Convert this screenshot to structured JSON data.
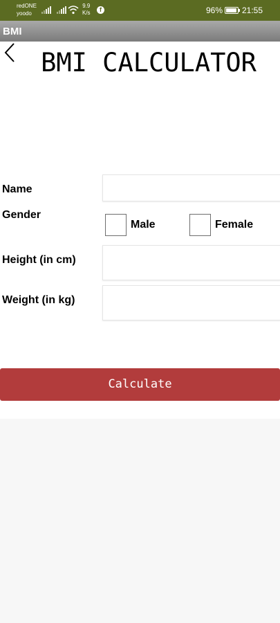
{
  "status_bar": {
    "carrier_line1": "redONE",
    "carrier_line2": "yoodo",
    "speed_value": "9.9",
    "speed_unit": "K/s",
    "battery_percent": "96%",
    "battery_level": 0.96,
    "time": "21:55",
    "icons": [
      "signal-icon",
      "signal-icon",
      "wifi-icon",
      "facebook-icon",
      "battery-icon"
    ]
  },
  "app_bar": {
    "title": "BMI"
  },
  "header": {
    "title": "BMI CALCULATOR",
    "back_icon": "chevron-left-icon"
  },
  "form": {
    "name_label": "Name",
    "name_value": "",
    "gender_label": "Gender",
    "male_label": "Male",
    "male_checked": false,
    "female_label": "Female",
    "female_checked": false,
    "height_label": "Height (in cm)",
    "height_value": "",
    "weight_label": "Weight (in kg)",
    "weight_value": ""
  },
  "actions": {
    "calculate_label": "Calculate"
  },
  "colors": {
    "status_bar": "#5b6b22",
    "app_bar": "#8e8e8e",
    "button": "#b23c3c",
    "background": "#f7f7f7"
  }
}
